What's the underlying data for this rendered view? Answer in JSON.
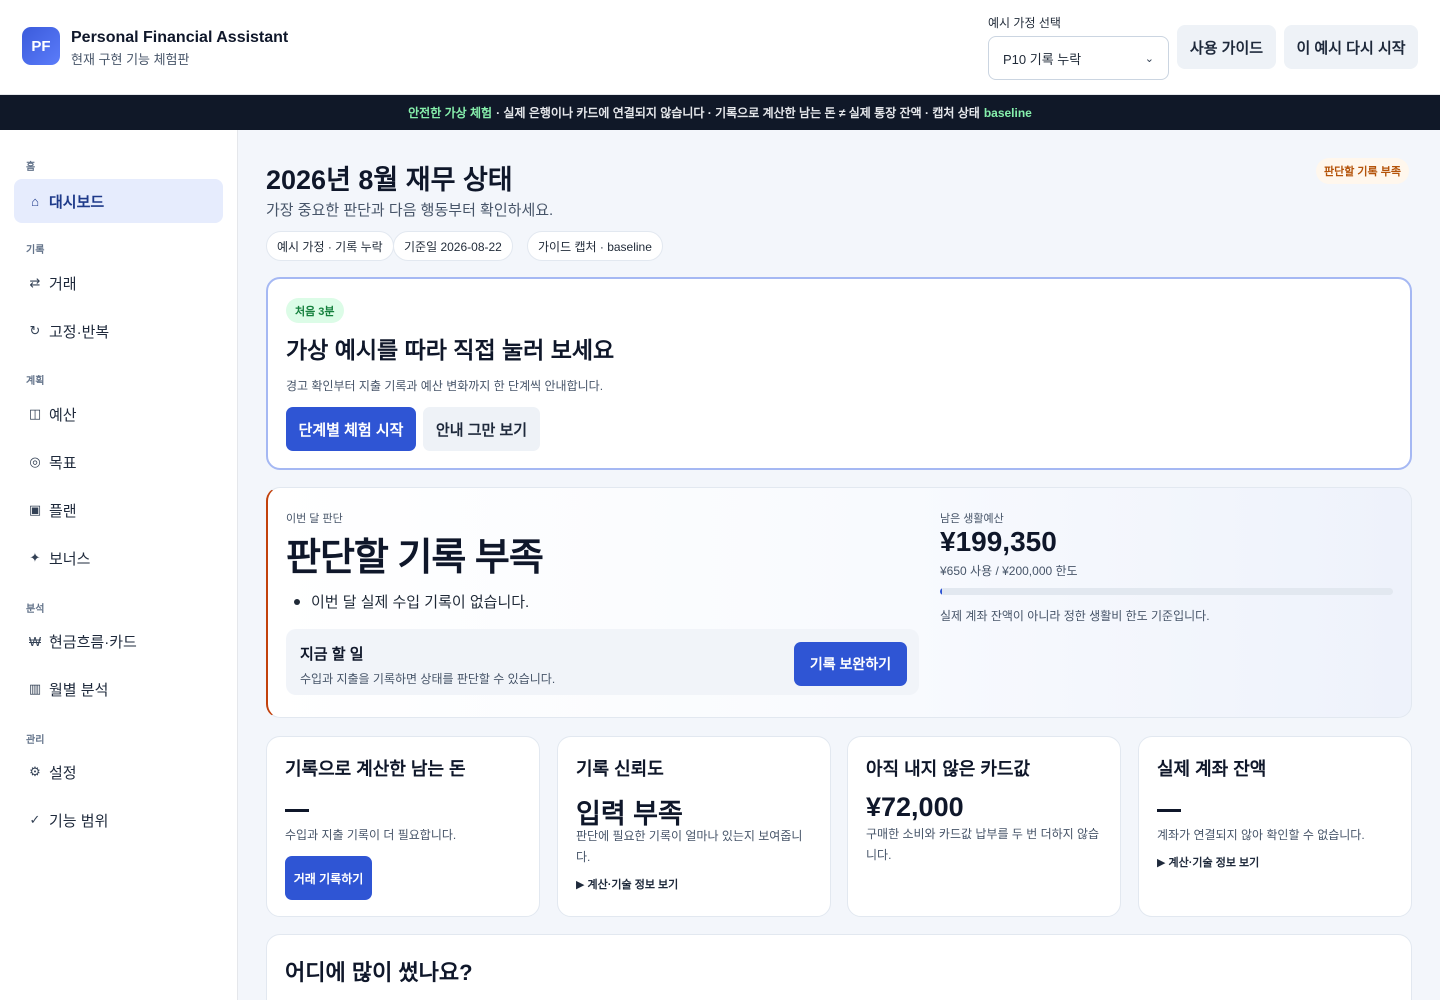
{
  "header": {
    "logo": "PF",
    "title": "Personal Financial Assistant",
    "subtitle": "현재 구현 기능 체험판",
    "scenario_label": "예시 가정 선택",
    "scenario_value": "P10 기록 누락",
    "guide_button": "사용 가이드",
    "restart_button": "이 예시 다시 시작"
  },
  "banner": {
    "accent": "안전한 가상 체험",
    "text_1": "· 실제 은행이나 카드에 연결되지 않습니다 · 기록으로 계산한 남는 돈 ≠ 실제 통장 잔액 · 캡처 상태",
    "capture_state": "baseline"
  },
  "sidebar": {
    "sections": [
      "홈",
      "기록",
      "계획",
      "분석",
      "관리"
    ],
    "items": [
      {
        "label": "대시보드",
        "icon": "home-icon",
        "glyph": "⌂"
      },
      {
        "label": "거래",
        "icon": "transfer-icon",
        "glyph": "⇄"
      },
      {
        "label": "고정·반복",
        "icon": "repeat-icon",
        "glyph": "↻"
      },
      {
        "label": "예산",
        "icon": "budget-icon",
        "glyph": "◫"
      },
      {
        "label": "목표",
        "icon": "target-icon",
        "glyph": "◎"
      },
      {
        "label": "플랜",
        "icon": "plan-icon",
        "glyph": "▣"
      },
      {
        "label": "보너스",
        "icon": "sparkle-icon",
        "glyph": "✦"
      },
      {
        "label": "현금흐름·카드",
        "icon": "won-icon",
        "glyph": "₩"
      },
      {
        "label": "월별 분석",
        "icon": "calendar-icon",
        "glyph": "▥"
      },
      {
        "label": "설정",
        "icon": "gear-icon",
        "glyph": "⚙"
      },
      {
        "label": "기능 범위",
        "icon": "check-icon",
        "glyph": "✓"
      }
    ]
  },
  "main": {
    "title": "2026년 8월 재무 상태",
    "subtitle": "가장 중요한 판단과 다음 행동부터 확인하세요.",
    "status_badge": "판단할 기록 부족",
    "chips": [
      "예시 가정 · 기록 누락",
      "기준일 2026-08-22",
      "가이드 캡처 · baseline"
    ],
    "intro": {
      "badge": "처음 3분",
      "title": "가상 예시를 따라 직접 눌러 보세요",
      "desc": "경고 확인부터 지출 기록과 예산 변화까지 한 단계씩 안내합니다.",
      "start_button": "단계별 체험 시작",
      "dismiss_button": "안내 그만 보기"
    },
    "judgement": {
      "label": "이번 달 판단",
      "title": "판단할 기록 부족",
      "bullet": "이번 달 실제 수입 기록이 없습니다.",
      "todo_title": "지금 할 일",
      "todo_desc": "수입과 지출을 기록하면 상태를 판단할 수 있습니다.",
      "todo_button": "기록 보완하기",
      "budget_label": "남은 생활예산",
      "budget_amount": "¥199,350",
      "budget_usage": "¥650 사용 / ¥200,000 한도",
      "budget_used_fraction": 0.00325,
      "budget_note": "실제 계좌 잔액이 아니라 정한 생활비 한도 기준입니다."
    },
    "metrics": [
      {
        "title": "기록으로 계산한 남는 돈",
        "value": "—",
        "desc": "수입과 지출 기록이 더 필요합니다.",
        "button": "거래 기록하기"
      },
      {
        "title": "기록 신뢰도",
        "value": "입력 부족",
        "desc": "판단에 필요한 기록이 얼마나 있는지 보여줍니다.",
        "toggle": "▶ 계산·기술 정보 보기"
      },
      {
        "title": "아직 내지 않은 카드값",
        "value": "¥72,000",
        "desc": "구매한 소비와 카드값 납부를 두 번 더하지 않습니다."
      },
      {
        "title": "실제 계좌 잔액",
        "value": "—",
        "desc": "계좌가 연결되지 않아 확인할 수 없습니다.",
        "toggle": "▶ 계산·기술 정보 보기"
      }
    ],
    "spend_title": "어디에 많이 썼나요?"
  }
}
